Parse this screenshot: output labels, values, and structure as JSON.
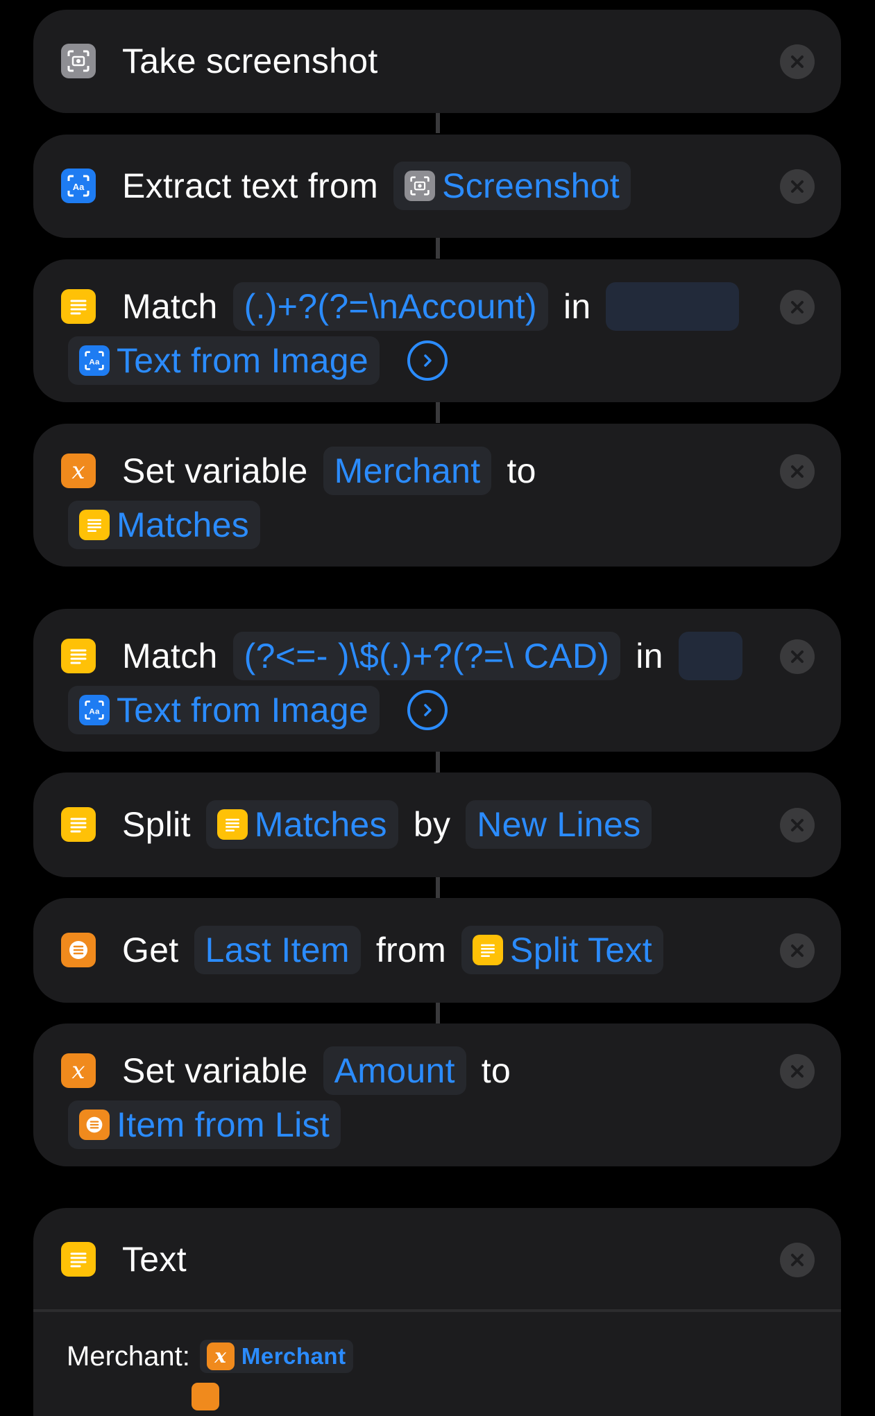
{
  "actions": {
    "screenshot": {
      "verb": "Take screenshot"
    },
    "extract": {
      "verb": "Extract text from",
      "input": "Screenshot"
    },
    "match1": {
      "verb": "Match",
      "pattern": "(.)+?(?=\\nAccount)",
      "in_label": "in",
      "input": "Text from Image"
    },
    "setvar1": {
      "verb": "Set variable",
      "name": "Merchant",
      "to_label": "to",
      "value": "Matches"
    },
    "match2": {
      "verb": "Match",
      "pattern": "(?<=- )\\$(.)+?(?=\\ CAD)",
      "in_label": "in",
      "input": "Text from Image"
    },
    "split": {
      "verb": "Split",
      "input": "Matches",
      "by_label": "by",
      "separator": "New Lines"
    },
    "get": {
      "verb": "Get",
      "item": "Last Item",
      "from_label": "from",
      "source": "Split Text"
    },
    "setvar2": {
      "verb": "Set variable",
      "name": "Amount",
      "to_label": "to",
      "value": "Item from List"
    },
    "text": {
      "verb": "Text",
      "line1_label": "Merchant:",
      "line1_var": "Merchant"
    }
  },
  "icons": {
    "screenshot": "screenshot-icon",
    "extract": "text-recognition-icon",
    "match": "text-lines-icon",
    "variable": "variable-x-icon",
    "list": "list-icon",
    "close": "close-icon",
    "chevron": "chevron-right-circle-icon"
  },
  "colors": {
    "background": "#000000",
    "card": "#1c1c1e",
    "accent": "#2b8cff",
    "token_bg": "#26282d",
    "text_yellow": "#ffc107",
    "variable_orange": "#f08a1d",
    "scripting_blue": "#1e7cf2",
    "close_bg": "#3a3a3c"
  }
}
